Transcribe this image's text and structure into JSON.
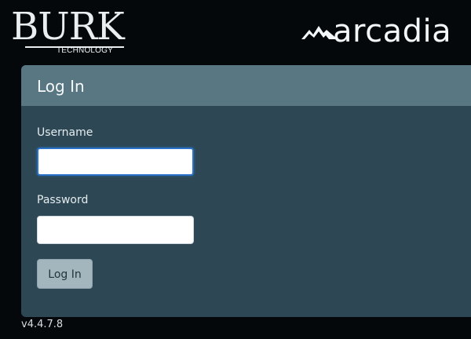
{
  "header": {
    "left_logo": {
      "main": "BURK",
      "sub": "TECHNOLOGY"
    },
    "right_logo": {
      "word": "arcadia",
      "mark_icon": "mountain-icon"
    }
  },
  "login_panel": {
    "title": "Log In",
    "username_label": "Username",
    "username_value": "",
    "password_label": "Password",
    "password_value": "",
    "submit_label": "Log In"
  },
  "footer": {
    "version": "v4.4.7.8"
  },
  "colors": {
    "background": "#05080a",
    "panel": "#2d4854",
    "panel_header": "#587783",
    "button": "#a3b5bd",
    "focus": "#2a72c9"
  }
}
